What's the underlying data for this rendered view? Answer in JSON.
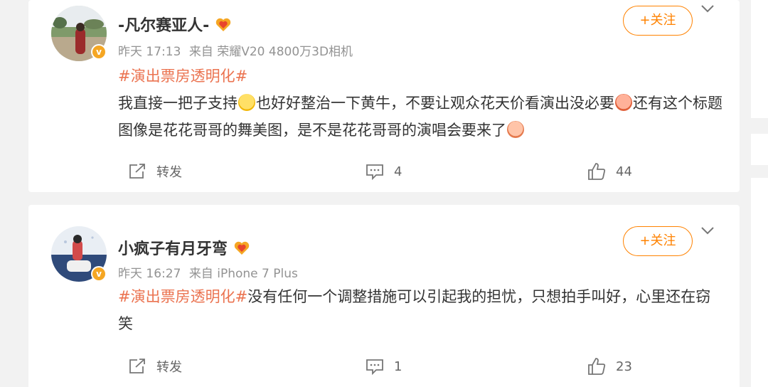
{
  "posts": [
    {
      "username": "-凡尔赛亚人-",
      "time": "昨天 17:13",
      "source": "来自 荣耀V20 4800万3D相机",
      "follow_label": "+关注",
      "hashtag": "#演出票房透明化#",
      "text_part1": "我直接一把子支持",
      "text_part2": "也好好整治一下黄牛，不要让观众花天价看演出没必要",
      "text_part3": "还有这个标题图像是花花哥哥的舞美图，是不是花花哥哥的演唱会要来了",
      "repost_label": "转发",
      "comment_count": "4",
      "like_count": "44",
      "emojis": [
        "laughing-crying-emoji",
        "shocked-emoji",
        "fist-emoji"
      ]
    },
    {
      "username": "小疯子有月牙弯",
      "time": "昨天 16:27",
      "source": "来自 iPhone 7 Plus",
      "follow_label": "+关注",
      "hashtag": "#演出票房透明化#",
      "text_part1": "没有任何一个调整措施可以引起我的担忧，只想拍手叫好，心里还在窃笑",
      "repost_label": "转发",
      "comment_count": "1",
      "like_count": "23"
    }
  ],
  "colors": {
    "accent": "#ff8200",
    "hashtag": "#eb7350",
    "verified": "#f5a623",
    "text": "#333333",
    "meta": "#939393"
  }
}
